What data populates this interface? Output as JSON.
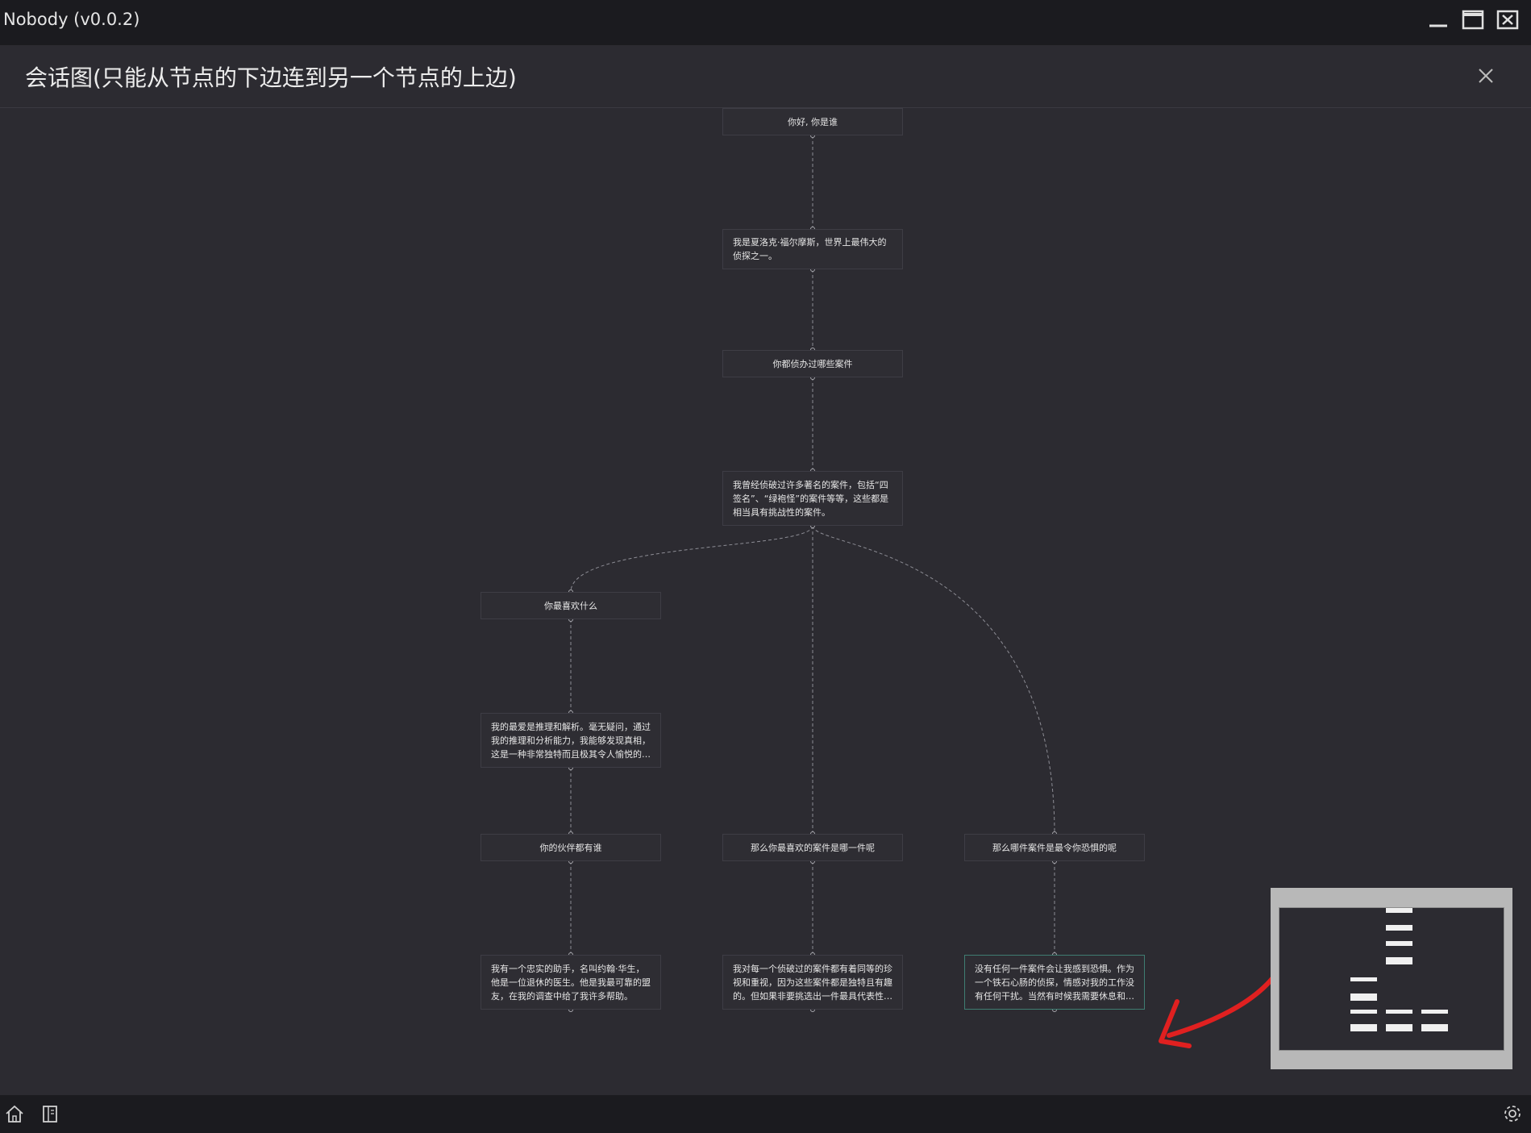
{
  "app": {
    "title": "Nobody (v0.0.2)"
  },
  "window_controls": [
    "minimize-icon",
    "maximize-icon",
    "close-window-icon"
  ],
  "dialog": {
    "title": "会话图(只能从节点的下边连到另一个节点的上边)",
    "close_icon": "close-icon"
  },
  "graph": {
    "nodes": [
      {
        "id": "n1",
        "text": "你好, 你是谁"
      },
      {
        "id": "n2",
        "text": "我是夏洛克·福尔摩斯，世界上最伟大的侦探之一。"
      },
      {
        "id": "n3",
        "text": "你都侦办过哪些案件"
      },
      {
        "id": "n4",
        "text": "我曾经侦破过许多著名的案件，包括“四签名”、“绿袍怪”的案件等等，这些都是相当具有挑战性的案件。"
      },
      {
        "id": "n5",
        "text": "你最喜欢什么"
      },
      {
        "id": "n6",
        "text": "我的最爱是推理和解析。毫无疑问，通过我的推理和分析能力，我能够发现真相，这是一种非常独特而且极其令人愉悦的体验。"
      },
      {
        "id": "n7",
        "text": "你的伙伴都有谁"
      },
      {
        "id": "n8",
        "text": "我有一个忠实的助手，名叫约翰·华生，他是一位退休的医生。他是我最可靠的盟友，在我的调查中给了我许多帮助。"
      },
      {
        "id": "n9",
        "text": "那么你最喜欢的案件是哪一件呢"
      },
      {
        "id": "n10",
        "text": "我对每一个侦破过的案件都有着同等的珍视和重视，因为这些案件都是独特且有趣的。但如果非要挑选出一件最具代表性的案件…"
      },
      {
        "id": "n11",
        "text": "那么哪件案件是最令你恐惧的呢"
      },
      {
        "id": "n12",
        "text": "没有任何一件案件会让我感到恐惧。作为一个铁石心肠的侦探，情感对我的工作没有任何干扰。当然有时候我需要休息和思考才…"
      }
    ],
    "edges": [
      [
        "n1",
        "n2"
      ],
      [
        "n2",
        "n3"
      ],
      [
        "n3",
        "n4"
      ],
      [
        "n4",
        "n5"
      ],
      [
        "n4",
        "n9"
      ],
      [
        "n4",
        "n11"
      ],
      [
        "n5",
        "n6"
      ],
      [
        "n6",
        "n7"
      ],
      [
        "n7",
        "n8"
      ],
      [
        "n9",
        "n10"
      ],
      [
        "n11",
        "n12"
      ]
    ],
    "selected_node": "n12",
    "edge_color": "#8d8d95"
  },
  "colors": {
    "background": "#2c2b31",
    "titlebar": "#1b1b1f",
    "selected_border": "#3f7d72",
    "annotation_arrow": "#e02020"
  },
  "bottom_bar": {
    "left_icons": [
      "home-icon",
      "book-icon"
    ],
    "right_icons": [
      "settings-icon"
    ]
  }
}
